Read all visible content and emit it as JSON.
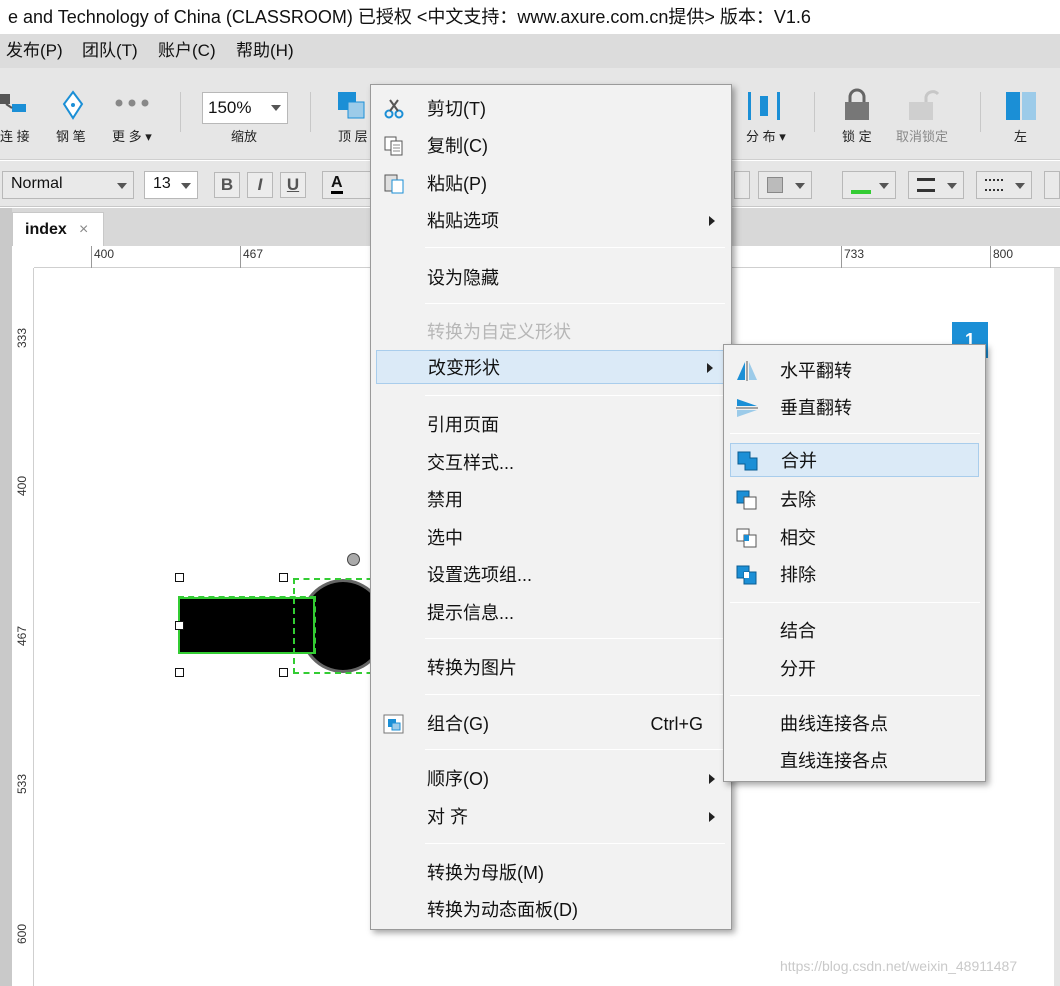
{
  "window": {
    "title": "e and Technology of China (CLASSROOM) 已授权     <中文支持：www.axure.com.cn提供> 版本：V1.6"
  },
  "menubar": [
    "发布(P)",
    "团队(T)",
    "账户(C)",
    "帮助(H)"
  ],
  "toolbar": {
    "connect_label": "连 接",
    "pen_label": "钢 笔",
    "more_label": "更 多 ▾",
    "zoom_value": "150%",
    "zoom_label": "缩放",
    "front_label": "顶 层",
    "distribute_label": "分 布 ▾",
    "lock_label": "锁 定",
    "unlock_label": "取消锁定",
    "left_label": "左"
  },
  "format": {
    "style": "Normal",
    "size": "13",
    "bold": "B",
    "italic": "I",
    "underline": "U",
    "font_color": "A"
  },
  "tab": {
    "label": "index",
    "close": "×"
  },
  "ruler": {
    "top": [
      "400",
      "467",
      "733",
      "800"
    ],
    "left": [
      "333",
      "400",
      "467",
      "533",
      "600"
    ]
  },
  "canvas": {
    "badge": "1"
  },
  "context_menu": {
    "items": [
      {
        "label": "剪切(T)",
        "icon": "scissors-icon"
      },
      {
        "label": "复制(C)",
        "icon": "copy-icon"
      },
      {
        "label": "粘贴(P)",
        "icon": "paste-icon"
      },
      {
        "label": "粘贴选项",
        "submenu": true
      },
      {
        "label": "设为隐藏"
      },
      {
        "label": "转换为自定义形状",
        "disabled": true
      },
      {
        "label": "改变形状",
        "submenu": true,
        "highlighted": true
      },
      {
        "label": "引用页面"
      },
      {
        "label": "交互样式..."
      },
      {
        "label": "禁用"
      },
      {
        "label": "选中"
      },
      {
        "label": "设置选项组..."
      },
      {
        "label": "提示信息..."
      },
      {
        "label": "转换为图片"
      },
      {
        "label": "组合(G)",
        "shortcut": "Ctrl+G",
        "icon": "group-icon"
      },
      {
        "label": "顺序(O)",
        "submenu": true
      },
      {
        "label": "对 齐",
        "submenu": true
      },
      {
        "label": "转换为母版(M)"
      },
      {
        "label": "转换为动态面板(D)"
      }
    ]
  },
  "shape_submenu": {
    "items": [
      {
        "label": "水平翻转",
        "icon": "flip-horizontal-icon"
      },
      {
        "label": "垂直翻转",
        "icon": "flip-vertical-icon"
      },
      {
        "label": "合并",
        "icon": "union-icon",
        "highlighted": true
      },
      {
        "label": "去除",
        "icon": "subtract-icon"
      },
      {
        "label": "相交",
        "icon": "intersect-icon"
      },
      {
        "label": "排除",
        "icon": "exclude-icon"
      },
      {
        "label": "结合"
      },
      {
        "label": "分开"
      },
      {
        "label": "曲线连接各点"
      },
      {
        "label": "直线连接各点"
      }
    ]
  },
  "watermark": "https://blog.csdn.net/weixin_48911487",
  "colors": {
    "accent": "#1b8fd6",
    "selection": "#33cc33",
    "highlight": "#dbeaf7"
  }
}
